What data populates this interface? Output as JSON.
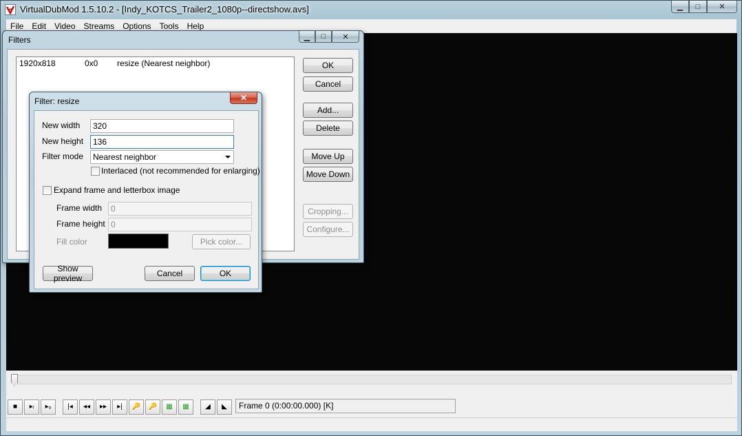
{
  "main_window": {
    "title": "VirtualDubMod 1.5.10.2 - [Indy_KOTCS_Trailer2_1080p--directshow.avs]",
    "controls": {
      "minimize": "▁",
      "maximize": "□",
      "close": "✕"
    },
    "menu": [
      "File",
      "Edit",
      "Video",
      "Streams",
      "Options",
      "Tools",
      "Help"
    ],
    "frame_status": "Frame 0 (0:00:00.000) [K]",
    "seek_position": 0
  },
  "toolbar_icons": [
    "stop-icon",
    "play-input-icon",
    "play-output-icon",
    "go-start-icon",
    "step-back-icon",
    "step-forward-icon",
    "go-end-icon",
    "prev-keyframe-icon",
    "next-keyframe-icon",
    "scene-back-icon",
    "scene-forward-icon",
    "mark-in-icon",
    "mark-out-icon"
  ],
  "filters_dialog": {
    "title": "Filters",
    "controls": {
      "minimize": "▁",
      "maximize": "□",
      "close": "✕"
    },
    "rows": [
      {
        "size": "1920x818",
        "offset": "0x0",
        "name": "resize (Nearest neighbor)"
      }
    ],
    "buttons": {
      "ok": "OK",
      "cancel": "Cancel",
      "add": "Add...",
      "delete": "Delete",
      "move_up": "Move Up",
      "move_down": "Move Down",
      "cropping": "Cropping...",
      "configure": "Configure..."
    }
  },
  "resize_dialog": {
    "title": "Filter: resize",
    "close": "✕",
    "new_width_label": "New width",
    "new_width_value": "320",
    "new_height_label": "New height",
    "new_height_value": "136",
    "filter_mode_label": "Filter mode",
    "filter_mode_value": "Nearest neighbor",
    "interlaced_label": "Interlaced (not recommended for enlarging)",
    "interlaced_checked": false,
    "expand_label": "Expand frame and letterbox image",
    "expand_checked": false,
    "frame_width_label": "Frame width",
    "frame_width_value": "0",
    "frame_height_label": "Frame height",
    "frame_height_value": "0",
    "fill_color_label": "Fill color",
    "fill_color": "#000000",
    "pick_color": "Pick color...",
    "show_preview": "Show preview",
    "cancel": "Cancel",
    "ok": "OK"
  }
}
